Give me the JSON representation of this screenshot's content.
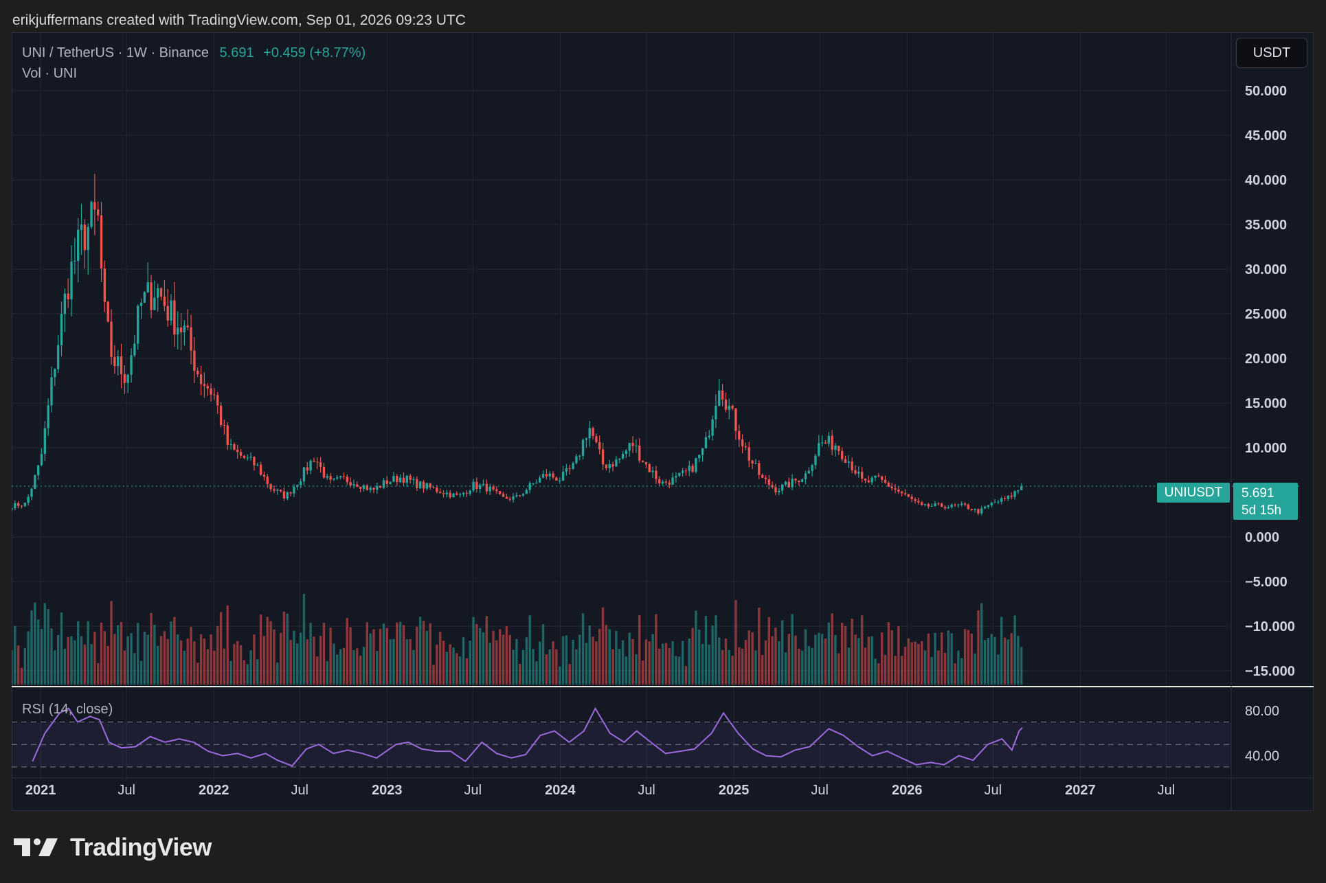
{
  "attribution": "erikjuffermans created with TradingView.com, Sep 01, 2026 09:23 UTC",
  "legend": {
    "symbol": "UNI / TetherUS · 1W · Binance",
    "price": "5.691",
    "change": "+0.459 (+8.77%)",
    "volume": "Vol · UNI",
    "rsi": "RSI (14, close)"
  },
  "currency_button": "USDT",
  "price_tag": {
    "symbol": "UNIUSDT",
    "price": "5.691",
    "countdown": "5d 15h"
  },
  "brand": "TradingView",
  "colors": {
    "up": "#26a69a",
    "down": "#ef5350",
    "rsi": "#9c6ade",
    "background": "#141823"
  },
  "chart_data": [
    {
      "type": "candlestick",
      "title": "UNI / TetherUS · 1W · Binance",
      "interval": "1W",
      "ylim": [
        -15,
        50
      ],
      "y_ticks": [
        "50.000",
        "45.000",
        "40.000",
        "35.000",
        "30.000",
        "25.000",
        "20.000",
        "15.000",
        "10.000",
        "0.000",
        "−5.000",
        "−10.000",
        "−15.000"
      ],
      "y_tick_values": [
        50,
        45,
        40,
        35,
        30,
        25,
        20,
        15,
        10,
        0,
        -5,
        -10,
        -15
      ],
      "x_ticks": [
        "2021",
        "Jul",
        "2022",
        "Jul",
        "2023",
        "Jul",
        "2024",
        "Jul",
        "2025",
        "Jul",
        "2026",
        "Jul",
        "2027",
        "Jul"
      ],
      "x_tick_dates": [
        "2021-01-01",
        "2021-07-01",
        "2022-01-01",
        "2022-07-01",
        "2023-01-01",
        "2023-07-01",
        "2024-01-01",
        "2024-07-01",
        "2025-01-01",
        "2025-07-01",
        "2026-01-01",
        "2026-07-01",
        "2027-01-01",
        "2027-07-01"
      ],
      "x_range": [
        "2020-11-01",
        "2027-11-15"
      ],
      "last_price": 5.691,
      "grid": true,
      "close_series": [
        {
          "date": "2020-11-01",
          "close": 3.5
        },
        {
          "date": "2020-12-01",
          "close": 3.7
        },
        {
          "date": "2021-01-01",
          "close": 8.5
        },
        {
          "date": "2021-02-01",
          "close": 20
        },
        {
          "date": "2021-03-01",
          "close": 29
        },
        {
          "date": "2021-04-01",
          "close": 34
        },
        {
          "date": "2021-05-01",
          "close": 36
        },
        {
          "date": "2021-05-15",
          "close": 25
        },
        {
          "date": "2021-06-01",
          "close": 20
        },
        {
          "date": "2021-07-01",
          "close": 18
        },
        {
          "date": "2021-08-01",
          "close": 26
        },
        {
          "date": "2021-09-01",
          "close": 28
        },
        {
          "date": "2021-10-01",
          "close": 25
        },
        {
          "date": "2021-11-01",
          "close": 23
        },
        {
          "date": "2021-12-01",
          "close": 18
        },
        {
          "date": "2022-01-01",
          "close": 16
        },
        {
          "date": "2022-02-01",
          "close": 10
        },
        {
          "date": "2022-03-01",
          "close": 9
        },
        {
          "date": "2022-04-01",
          "close": 8
        },
        {
          "date": "2022-05-01",
          "close": 5.5
        },
        {
          "date": "2022-06-01",
          "close": 4.5
        },
        {
          "date": "2022-07-01",
          "close": 6.5
        },
        {
          "date": "2022-08-01",
          "close": 9
        },
        {
          "date": "2022-09-01",
          "close": 6
        },
        {
          "date": "2022-10-01",
          "close": 6.5
        },
        {
          "date": "2022-11-01",
          "close": 6
        },
        {
          "date": "2022-12-01",
          "close": 5.2
        },
        {
          "date": "2023-01-01",
          "close": 6.2
        },
        {
          "date": "2023-02-01",
          "close": 6.7
        },
        {
          "date": "2023-03-01",
          "close": 6
        },
        {
          "date": "2023-04-01",
          "close": 5.5
        },
        {
          "date": "2023-05-01",
          "close": 5
        },
        {
          "date": "2023-06-01",
          "close": 4.5
        },
        {
          "date": "2023-07-01",
          "close": 5.8
        },
        {
          "date": "2023-08-01",
          "close": 5.5
        },
        {
          "date": "2023-09-01",
          "close": 4.3
        },
        {
          "date": "2023-10-01",
          "close": 4.4
        },
        {
          "date": "2023-11-01",
          "close": 5.8
        },
        {
          "date": "2023-12-01",
          "close": 7
        },
        {
          "date": "2024-01-01",
          "close": 6.5
        },
        {
          "date": "2024-02-01",
          "close": 8
        },
        {
          "date": "2024-03-01",
          "close": 12.5
        },
        {
          "date": "2024-04-01",
          "close": 8
        },
        {
          "date": "2024-05-01",
          "close": 8.5
        },
        {
          "date": "2024-06-01",
          "close": 10.5
        },
        {
          "date": "2024-07-01",
          "close": 8
        },
        {
          "date": "2024-08-01",
          "close": 6
        },
        {
          "date": "2024-09-01",
          "close": 6.5
        },
        {
          "date": "2024-10-01",
          "close": 7.5
        },
        {
          "date": "2024-11-01",
          "close": 10
        },
        {
          "date": "2024-12-01",
          "close": 17.5
        },
        {
          "date": "2025-01-01",
          "close": 13
        },
        {
          "date": "2025-02-01",
          "close": 9
        },
        {
          "date": "2025-03-01",
          "close": 6.5
        },
        {
          "date": "2025-04-01",
          "close": 5.3
        },
        {
          "date": "2025-05-01",
          "close": 6
        },
        {
          "date": "2025-06-01",
          "close": 7
        },
        {
          "date": "2025-07-01",
          "close": 10.5
        },
        {
          "date": "2025-08-01",
          "close": 10.5
        },
        {
          "date": "2025-09-01",
          "close": 8.5
        },
        {
          "date": "2025-10-01",
          "close": 6
        },
        {
          "date": "2025-11-01",
          "close": 6.5
        },
        {
          "date": "2025-12-01",
          "close": 5.5
        },
        {
          "date": "2026-01-01",
          "close": 4.5
        },
        {
          "date": "2026-02-01",
          "close": 3.4
        },
        {
          "date": "2026-03-01",
          "close": 3.5
        },
        {
          "date": "2026-04-01",
          "close": 3.4
        },
        {
          "date": "2026-05-01",
          "close": 3.5
        },
        {
          "date": "2026-06-01",
          "close": 2.8
        },
        {
          "date": "2026-07-01",
          "close": 3.8
        },
        {
          "date": "2026-08-01",
          "close": 4.3
        },
        {
          "date": "2026-09-01",
          "close": 5.691
        }
      ]
    },
    {
      "type": "bar",
      "title": "Vol · UNI",
      "note": "weekly volume bars, colored by candle direction"
    },
    {
      "type": "line",
      "title": "RSI (14, close)",
      "ylim": [
        30,
        88
      ],
      "y_ticks": [
        "80.00",
        "40.00"
      ],
      "y_tick_values": [
        80,
        40
      ],
      "band": [
        30,
        70
      ],
      "midline": 50,
      "series": [
        {
          "date": "2020-12-15",
          "value": 35
        },
        {
          "date": "2021-01-10",
          "value": 60
        },
        {
          "date": "2021-02-10",
          "value": 78
        },
        {
          "date": "2021-03-01",
          "value": 82
        },
        {
          "date": "2021-03-20",
          "value": 70
        },
        {
          "date": "2021-04-15",
          "value": 75
        },
        {
          "date": "2021-05-05",
          "value": 72
        },
        {
          "date": "2021-05-25",
          "value": 52
        },
        {
          "date": "2021-06-20",
          "value": 47
        },
        {
          "date": "2021-07-20",
          "value": 48
        },
        {
          "date": "2021-08-20",
          "value": 57
        },
        {
          "date": "2021-09-20",
          "value": 52
        },
        {
          "date": "2021-10-20",
          "value": 55
        },
        {
          "date": "2021-11-20",
          "value": 52
        },
        {
          "date": "2021-12-20",
          "value": 44
        },
        {
          "date": "2022-01-20",
          "value": 40
        },
        {
          "date": "2022-02-20",
          "value": 42
        },
        {
          "date": "2022-03-20",
          "value": 38
        },
        {
          "date": "2022-04-20",
          "value": 42
        },
        {
          "date": "2022-05-15",
          "value": 36
        },
        {
          "date": "2022-06-15",
          "value": 31
        },
        {
          "date": "2022-07-15",
          "value": 46
        },
        {
          "date": "2022-08-10",
          "value": 50
        },
        {
          "date": "2022-09-10",
          "value": 42
        },
        {
          "date": "2022-10-10",
          "value": 45
        },
        {
          "date": "2022-11-10",
          "value": 42
        },
        {
          "date": "2022-12-10",
          "value": 38
        },
        {
          "date": "2023-01-20",
          "value": 50
        },
        {
          "date": "2023-02-15",
          "value": 52
        },
        {
          "date": "2023-03-15",
          "value": 46
        },
        {
          "date": "2023-04-15",
          "value": 44
        },
        {
          "date": "2023-05-15",
          "value": 44
        },
        {
          "date": "2023-06-15",
          "value": 35
        },
        {
          "date": "2023-07-20",
          "value": 52
        },
        {
          "date": "2023-08-20",
          "value": 42
        },
        {
          "date": "2023-09-20",
          "value": 38
        },
        {
          "date": "2023-10-20",
          "value": 41
        },
        {
          "date": "2023-11-20",
          "value": 58
        },
        {
          "date": "2023-12-20",
          "value": 62
        },
        {
          "date": "2024-01-20",
          "value": 52
        },
        {
          "date": "2024-02-20",
          "value": 62
        },
        {
          "date": "2024-03-15",
          "value": 82
        },
        {
          "date": "2024-04-15",
          "value": 60
        },
        {
          "date": "2024-05-15",
          "value": 52
        },
        {
          "date": "2024-06-10",
          "value": 62
        },
        {
          "date": "2024-07-10",
          "value": 52
        },
        {
          "date": "2024-08-10",
          "value": 42
        },
        {
          "date": "2024-09-10",
          "value": 44
        },
        {
          "date": "2024-10-10",
          "value": 46
        },
        {
          "date": "2024-11-15",
          "value": 60
        },
        {
          "date": "2024-12-10",
          "value": 78
        },
        {
          "date": "2025-01-10",
          "value": 60
        },
        {
          "date": "2025-02-10",
          "value": 46
        },
        {
          "date": "2025-03-10",
          "value": 40
        },
        {
          "date": "2025-04-10",
          "value": 39
        },
        {
          "date": "2025-05-10",
          "value": 45
        },
        {
          "date": "2025-06-10",
          "value": 48
        },
        {
          "date": "2025-07-20",
          "value": 64
        },
        {
          "date": "2025-08-20",
          "value": 58
        },
        {
          "date": "2025-09-20",
          "value": 48
        },
        {
          "date": "2025-10-20",
          "value": 40
        },
        {
          "date": "2025-11-20",
          "value": 44
        },
        {
          "date": "2025-12-20",
          "value": 38
        },
        {
          "date": "2026-01-20",
          "value": 32
        },
        {
          "date": "2026-02-20",
          "value": 34
        },
        {
          "date": "2026-03-20",
          "value": 32
        },
        {
          "date": "2026-04-20",
          "value": 40
        },
        {
          "date": "2026-05-20",
          "value": 36
        },
        {
          "date": "2026-06-20",
          "value": 50
        },
        {
          "date": "2026-07-20",
          "value": 55
        },
        {
          "date": "2026-08-10",
          "value": 45
        },
        {
          "date": "2026-08-25",
          "value": 62
        },
        {
          "date": "2026-09-01",
          "value": 65
        }
      ]
    }
  ]
}
